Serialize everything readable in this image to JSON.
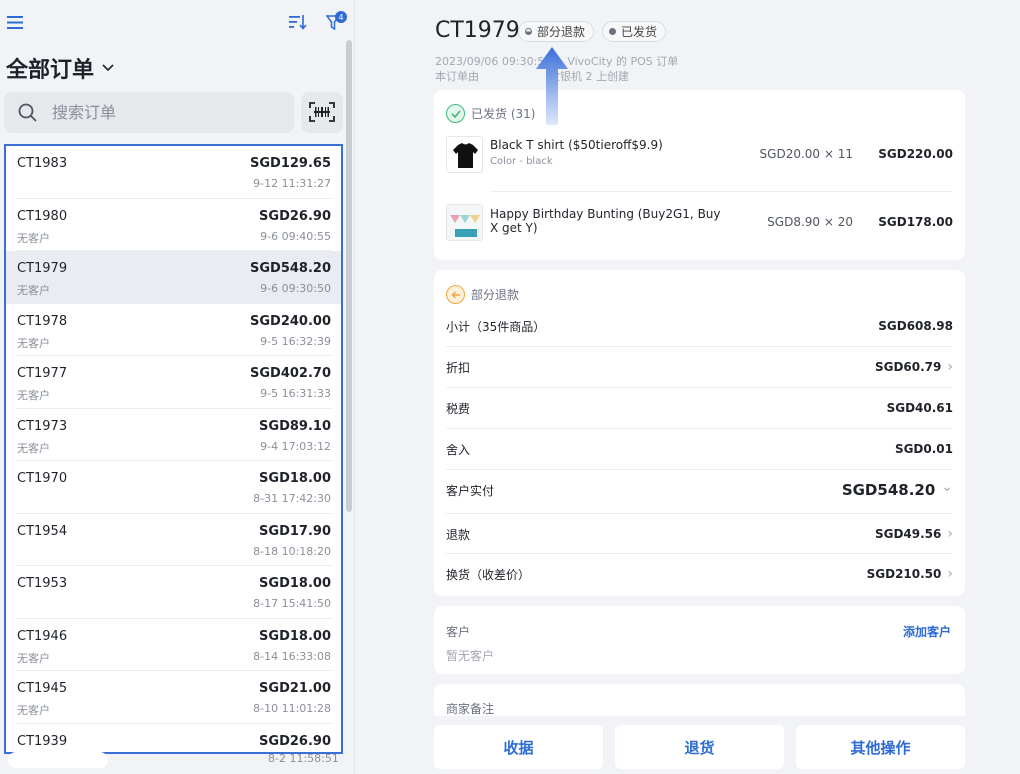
{
  "left": {
    "filter_count": "4",
    "title": "全部订单",
    "search_placeholder": "搜索订单",
    "orders": [
      {
        "id": "CT1983",
        "amount": "SGD129.65",
        "customer": "",
        "time": "9-12 11:31:27",
        "selected": false
      },
      {
        "id": "CT1980",
        "amount": "SGD26.90",
        "customer": "无客户",
        "time": "9-6 09:40:55",
        "selected": false
      },
      {
        "id": "CT1979",
        "amount": "SGD548.20",
        "customer": "无客户",
        "time": "9-6 09:30:50",
        "selected": true
      },
      {
        "id": "CT1978",
        "amount": "SGD240.00",
        "customer": "无客户",
        "time": "9-5 16:32:39",
        "selected": false
      },
      {
        "id": "CT1977",
        "amount": "SGD402.70",
        "customer": "无客户",
        "time": "9-5 16:31:33",
        "selected": false
      },
      {
        "id": "CT1973",
        "amount": "SGD89.10",
        "customer": "无客户",
        "time": "9-4 17:03:12",
        "selected": false
      },
      {
        "id": "CT1970",
        "amount": "SGD18.00",
        "customer": "",
        "time": "8-31 17:42:30",
        "selected": false
      },
      {
        "id": "CT1954",
        "amount": "SGD17.90",
        "customer": "",
        "time": "8-18 10:18:20",
        "selected": false
      },
      {
        "id": "CT1953",
        "amount": "SGD18.00",
        "customer": "",
        "time": "8-17 15:41:50",
        "selected": false
      },
      {
        "id": "CT1946",
        "amount": "SGD18.00",
        "customer": "无客户",
        "time": "8-14 16:33:08",
        "selected": false
      },
      {
        "id": "CT1945",
        "amount": "SGD21.00",
        "customer": "无客户",
        "time": "8-10 11:01:28",
        "selected": false
      },
      {
        "id": "CT1939",
        "amount": "SGD26.90",
        "customer": "",
        "time": "",
        "selected": false
      }
    ],
    "bottom_time": "8-2 11:58:51"
  },
  "detail": {
    "order_id": "CT1979",
    "badge_refund": "部分退款",
    "badge_shipped": "已发货",
    "meta_line1": "2023/09/06 09:30:50",
    "meta_line1_right": "VivoCity 的 POS 订单",
    "meta_line2_left": "本订单由",
    "meta_line2_right": "收银机 2 上创建",
    "shipped_section": "已发货 (31)",
    "items": [
      {
        "name": "Black T shirt ($50tieroff$9.9)",
        "variant": "Color - black",
        "qty": "SGD20.00 × 11",
        "total": "SGD220.00",
        "icon": "tshirt-thumbnail"
      },
      {
        "name": "Happy Birthday Bunting (Buy2G1, Buy X get Y)",
        "variant": "",
        "qty": "SGD8.90 × 20",
        "total": "SGD178.00",
        "icon": "bunting-thumbnail"
      }
    ],
    "refund_section": "部分退款",
    "summary": [
      {
        "label": "小计（35件商品）",
        "value": "SGD608.98",
        "chevron": ""
      },
      {
        "label": "折扣",
        "value": "SGD60.79",
        "chevron": "right"
      },
      {
        "label": "税费",
        "value": "SGD40.61",
        "chevron": ""
      },
      {
        "label": "舍入",
        "value": "SGD0.01",
        "chevron": ""
      },
      {
        "label": "客户实付",
        "value": "SGD548.20",
        "chevron": "down"
      },
      {
        "label": "退款",
        "value": "SGD49.56",
        "chevron": "right"
      },
      {
        "label": "换货（收差价）",
        "value": "SGD210.50",
        "chevron": "right"
      }
    ],
    "customer_label": "客户",
    "add_customer": "添加客户",
    "no_customer": "暂无客户",
    "merchant_note": "商家备注"
  },
  "footer": {
    "collect": "收据",
    "return": "退货",
    "more": "其他操作"
  },
  "colors": {
    "accent": "#2f6bd6",
    "selection_border": "#3a6fd8",
    "shipped_green": "#3cba7a",
    "refund_orange": "#f0a640"
  }
}
